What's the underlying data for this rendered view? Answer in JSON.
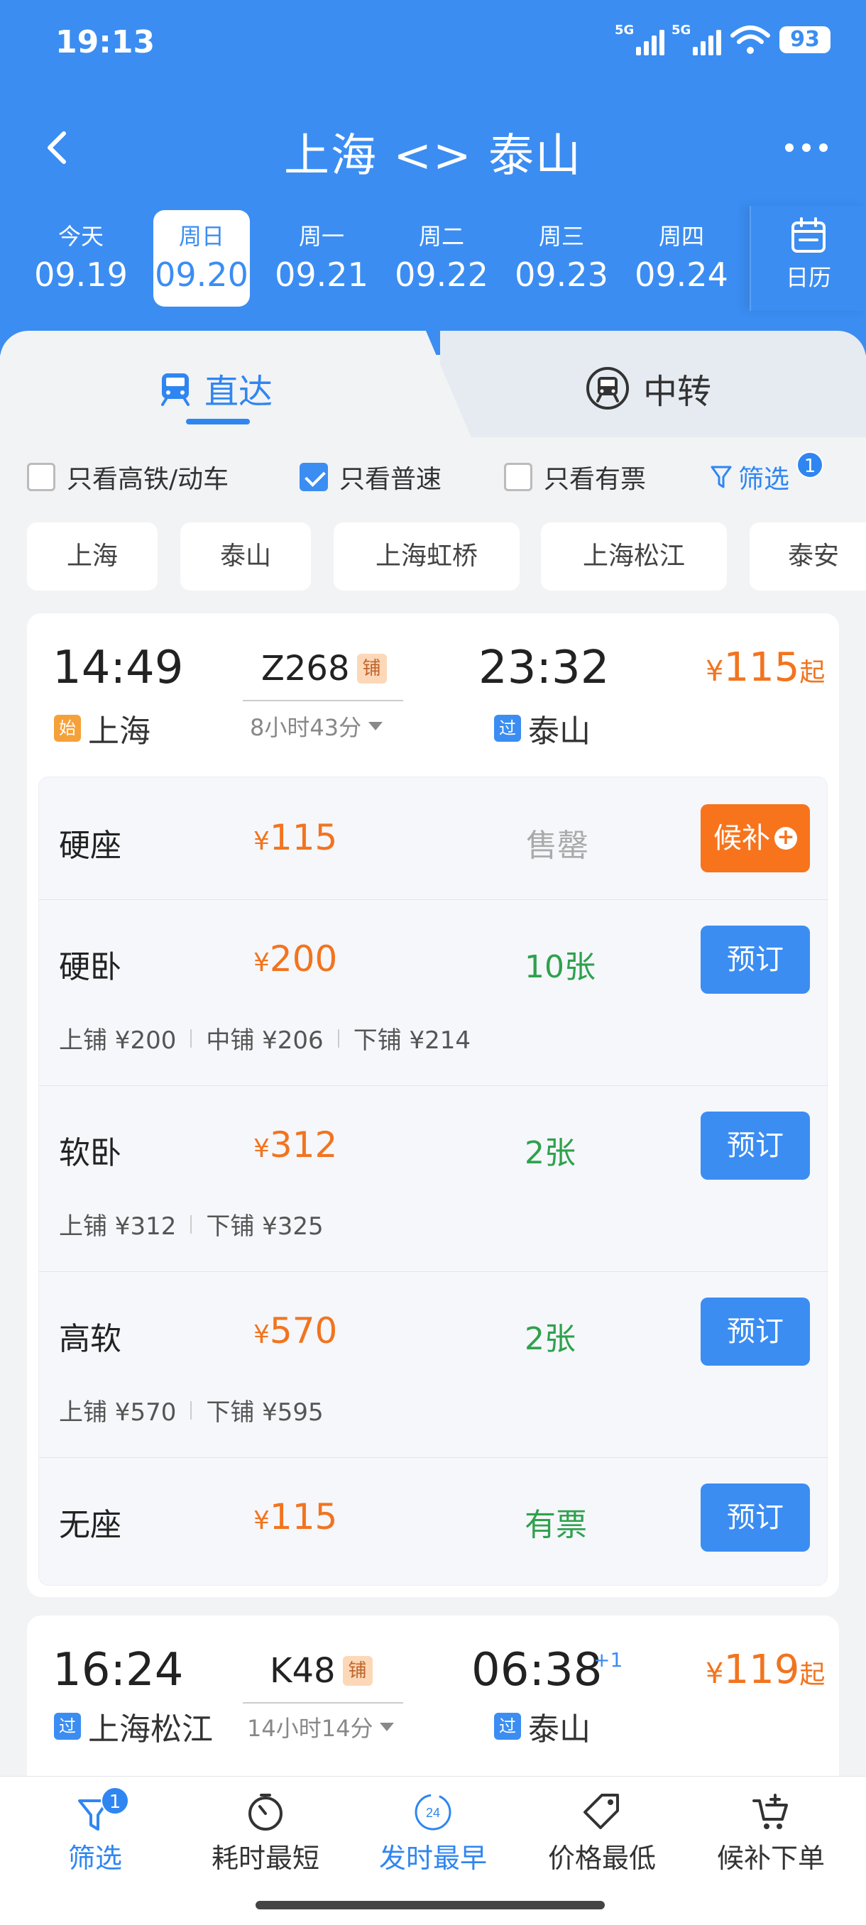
{
  "status": {
    "time": "19:13",
    "sim1": "5G",
    "sim2": "5G",
    "battery": "93"
  },
  "header": {
    "title": "上海 <> 泰山"
  },
  "dates": [
    {
      "weekday": "今天",
      "date": "09.19"
    },
    {
      "weekday": "周日",
      "date": "09.20",
      "active": true
    },
    {
      "weekday": "周一",
      "date": "09.21"
    },
    {
      "weekday": "周二",
      "date": "09.22"
    },
    {
      "weekday": "周三",
      "date": "09.23"
    },
    {
      "weekday": "周四",
      "date": "09.24"
    }
  ],
  "calendar_label": "日历",
  "tabs": {
    "direct": "直达",
    "transfer": "中转"
  },
  "filters": {
    "high_speed": "只看高铁/动车",
    "normal": "只看普速",
    "available": "只看有票",
    "filter": "筛选",
    "filter_count": "1"
  },
  "stations": [
    "上海",
    "泰山",
    "上海虹桥",
    "上海松江",
    "泰安"
  ],
  "trains": [
    {
      "dep_time": "14:49",
      "dep_tag": "始",
      "dep_station": "上海",
      "train_no": "Z268",
      "berth_tag": "铺",
      "duration": "8小时43分",
      "arr_time": "23:32",
      "arr_tag": "过",
      "arr_station": "泰山",
      "price_yen": "¥",
      "price": "115",
      "price_suffix": "起",
      "seats": [
        {
          "name": "硬座",
          "yen": "¥",
          "price": "115",
          "stock": "售罄",
          "button": "候补"
        },
        {
          "name": "硬卧",
          "yen": "¥",
          "price": "200",
          "stock": "10张",
          "button": "预订",
          "berths": [
            "上铺 ¥200",
            "中铺 ¥206",
            "下铺 ¥214"
          ]
        },
        {
          "name": "软卧",
          "yen": "¥",
          "price": "312",
          "stock": "2张",
          "button": "预订",
          "berths": [
            "上铺 ¥312",
            "下铺 ¥325"
          ]
        },
        {
          "name": "高软",
          "yen": "¥",
          "price": "570",
          "stock": "2张",
          "button": "预订",
          "berths": [
            "上铺 ¥570",
            "下铺 ¥595"
          ]
        },
        {
          "name": "无座",
          "yen": "¥",
          "price": "115",
          "stock": "有票",
          "button": "预订"
        }
      ]
    },
    {
      "dep_time": "16:24",
      "dep_tag": "过",
      "dep_station": "上海松江",
      "train_no": "K48",
      "berth_tag": "铺",
      "duration": "14小时14分",
      "arr_time": "06:38",
      "arr_plus": "+1",
      "arr_tag": "过",
      "arr_station": "泰山",
      "price_yen": "¥",
      "price": "119",
      "price_suffix": "起"
    }
  ],
  "bottom_nav": {
    "filter": "筛选",
    "filter_badge": "1",
    "shortest": "耗时最短",
    "earliest": "发时最早",
    "earliest_icon_text": "24",
    "cheapest": "价格最低",
    "waitlist": "候补下单"
  }
}
